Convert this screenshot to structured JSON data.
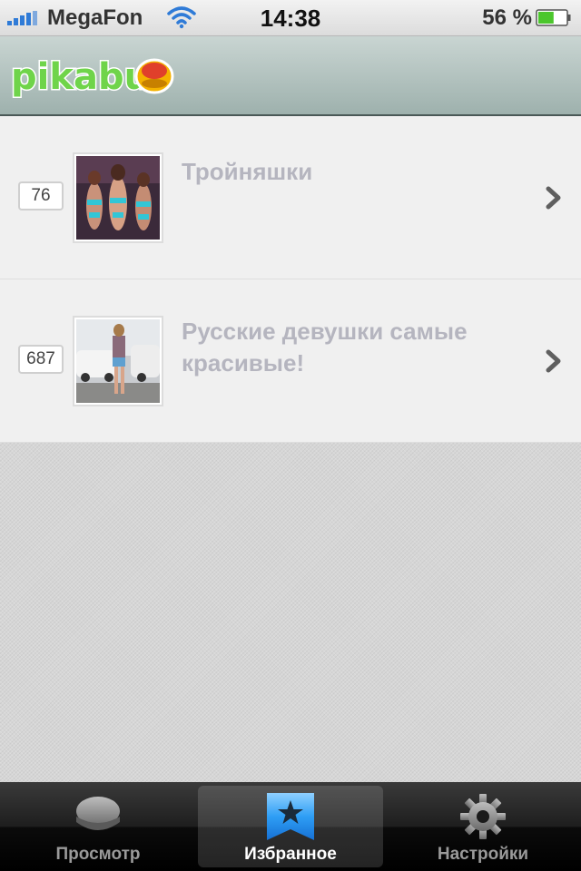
{
  "status_bar": {
    "carrier": "MegaFon",
    "time": "14:38",
    "battery": "56 %",
    "battery_level": 0.56
  },
  "header": {
    "logo": "pikabu"
  },
  "items": [
    {
      "count": "76",
      "title": "Тройняшки"
    },
    {
      "count": "687",
      "title": "Русские девушки самые красивые!"
    }
  ],
  "tabs": [
    {
      "label": "Просмотр",
      "icon": "cookie-icon",
      "active": false
    },
    {
      "label": "Избранное",
      "icon": "bookmark-star-icon",
      "active": true
    },
    {
      "label": "Настройки",
      "icon": "gear-icon",
      "active": false
    }
  ],
  "colors": {
    "header": "#a8b9b5",
    "accent": "#2f7bd7",
    "logo_green": "#7ed957"
  }
}
